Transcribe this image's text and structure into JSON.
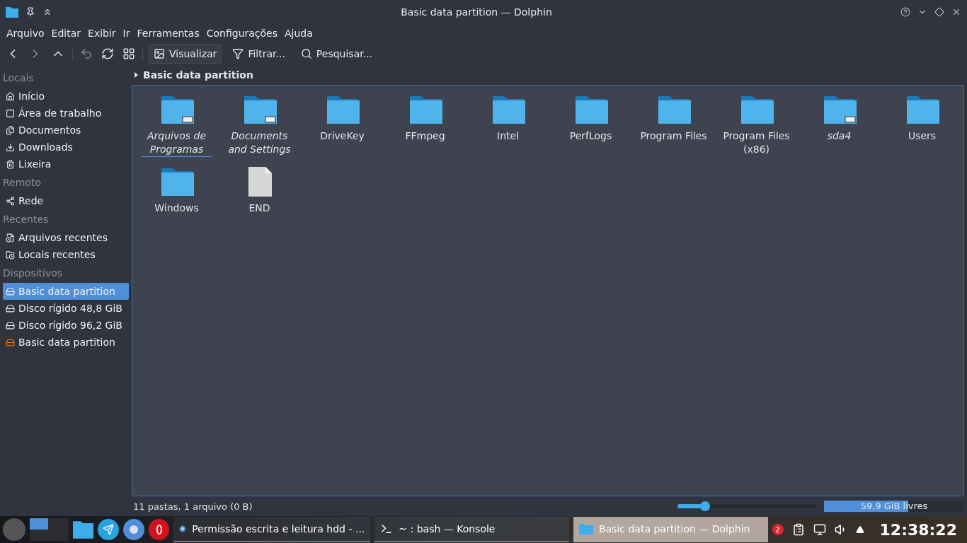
{
  "window": {
    "title": "Basic data partition — Dolphin"
  },
  "menu": [
    "Arquivo",
    "Editar",
    "Exibir",
    "Ir",
    "Ferramentas",
    "Configurações",
    "Ajuda"
  ],
  "toolbar": [
    {
      "label": "Visualizar",
      "selected": true
    },
    {
      "label": "Filtrar...",
      "selected": false
    },
    {
      "label": "Pesquisar...",
      "selected": false
    }
  ],
  "sidebar": [
    {
      "title": "Locais",
      "items": [
        {
          "label": "Início",
          "selected": false
        },
        {
          "label": "Área de trabalho",
          "selected": false
        },
        {
          "label": "Documentos",
          "selected": false
        },
        {
          "label": "Downloads",
          "selected": false
        },
        {
          "label": "Lixeira",
          "selected": false
        }
      ]
    },
    {
      "title": "Remoto",
      "items": [
        {
          "label": "Rede",
          "selected": false
        }
      ]
    },
    {
      "title": "Recentes",
      "items": [
        {
          "label": "Arquivos recentes",
          "selected": false
        },
        {
          "label": "Locais recentes",
          "selected": false
        }
      ]
    },
    {
      "title": "Dispositivos",
      "items": [
        {
          "label": "Basic data partition",
          "selected": true
        },
        {
          "label": "Disco rígido 48,8 GiB",
          "selected": false
        },
        {
          "label": "Disco rígido 96,2 GiB",
          "selected": false
        },
        {
          "label": "Basic data partition",
          "selected": false
        }
      ]
    }
  ],
  "breadcrumb": "Basic data partition",
  "files": [
    {
      "kind": "folder",
      "name": "Arquivos de Programas",
      "link": true,
      "selected": true
    },
    {
      "kind": "folder",
      "name": "Documents and Settings",
      "link": true,
      "selected": false
    },
    {
      "kind": "folder",
      "name": "DriveKey",
      "link": false,
      "selected": false
    },
    {
      "kind": "folder",
      "name": "FFmpeg",
      "link": false,
      "selected": false
    },
    {
      "kind": "folder",
      "name": "Intel",
      "link": false,
      "selected": false
    },
    {
      "kind": "folder",
      "name": "PerfLogs",
      "link": false,
      "selected": false
    },
    {
      "kind": "folder",
      "name": "Program Files",
      "link": false,
      "selected": false
    },
    {
      "kind": "folder",
      "name": "Program Files (x86)",
      "link": false,
      "selected": false
    },
    {
      "kind": "folder",
      "name": "sda4",
      "link": true,
      "selected": false
    },
    {
      "kind": "folder",
      "name": "Users",
      "link": false,
      "selected": false
    },
    {
      "kind": "folder",
      "name": "Windows",
      "link": false,
      "selected": false
    },
    {
      "kind": "file",
      "name": "END",
      "link": false,
      "selected": false
    }
  ],
  "status_bar": {
    "summary": "11 pastas, 1 arquivo (0 B)",
    "zoom": {
      "level": 0.2
    },
    "free_space": {
      "level": 0.6,
      "label": "59,9 GiB livres"
    }
  },
  "taskbar": {
    "tasks": [
      {
        "label": "Permissão escrita e leitura hdd - ...",
        "selected": false
      },
      {
        "label": "~ : bash — Konsole",
        "selected": false
      },
      {
        "label": "Basic data partition — Dolphin",
        "selected": true
      }
    ],
    "notifications": "2",
    "clock": "12:38:22"
  }
}
